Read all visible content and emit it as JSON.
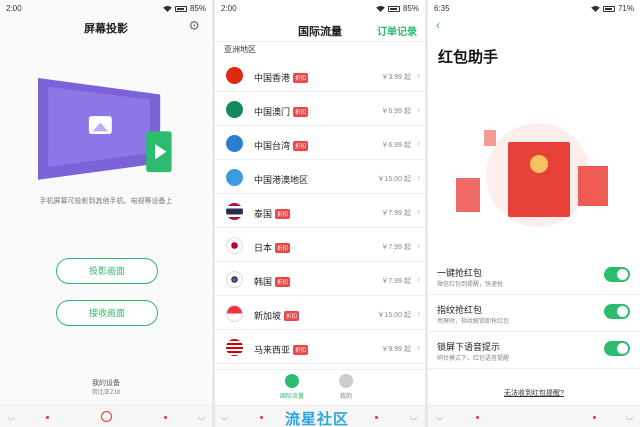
{
  "panel1": {
    "status": {
      "time": "2:00",
      "battery": "85%"
    },
    "title": "屏幕投影",
    "description": "手机屏幕可投影到其他手机、电视等设备上",
    "buttons": {
      "project": "投影画面",
      "receive": "接收画面"
    },
    "device_label": "我的设备",
    "device_name": "努比亚Z18"
  },
  "panel2": {
    "status": {
      "time": "2:00",
      "battery": "85%"
    },
    "title": "国际流量",
    "orders_link": "订单记录",
    "section": "亚洲地区",
    "regions": [
      {
        "name": "中国香港",
        "tag": "折扣",
        "price": "￥3.99 起",
        "flag": "hk"
      },
      {
        "name": "中国澳门",
        "tag": "折扣",
        "price": "￥6.99 起",
        "flag": "mo"
      },
      {
        "name": "中国台湾",
        "tag": "折扣",
        "price": "￥6.99 起",
        "flag": "tw"
      },
      {
        "name": "中国港澳地区",
        "tag": "",
        "price": "￥15.00 起",
        "flag": "hkmo"
      },
      {
        "name": "泰国",
        "tag": "折扣",
        "price": "￥7.99 起",
        "flag": "th"
      },
      {
        "name": "日本",
        "tag": "折扣",
        "price": "￥7.99 起",
        "flag": "jp"
      },
      {
        "name": "韩国",
        "tag": "折扣",
        "price": "￥7.99 起",
        "flag": "kr"
      },
      {
        "name": "新加坡",
        "tag": "折扣",
        "price": "￥15.00 起",
        "flag": "sg"
      },
      {
        "name": "马来西亚",
        "tag": "折扣",
        "price": "￥9.99 起",
        "flag": "my"
      }
    ],
    "tabs": {
      "traffic": "国际流量",
      "mine": "我的"
    },
    "watermark": "流星社区"
  },
  "panel3": {
    "status": {
      "time": "6:35",
      "battery": "71%"
    },
    "title": "红包助手",
    "settings": [
      {
        "label": "一键抢红包",
        "sub": "微信红包到提醒，快速抢",
        "on": true
      },
      {
        "label": "指纹抢红包",
        "sub": "亮屏时，指纹解锁即抢红包",
        "on": true
      },
      {
        "label": "锁屏下语音提示",
        "sub": "响铃模式下，红包语音提醒",
        "on": true
      }
    ],
    "help_link": "无法收到红包提醒?"
  },
  "colors": {
    "accent": "#2dbb6d",
    "nav_red": "#e33333",
    "tag_red": "#e94848",
    "envelope_red": "#e8413a"
  }
}
